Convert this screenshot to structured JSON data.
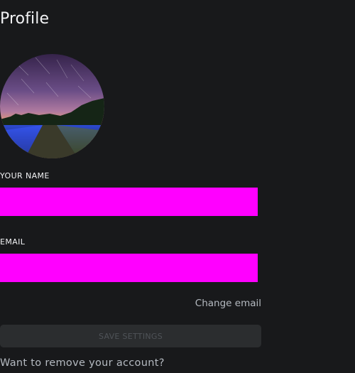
{
  "page": {
    "title": "Profile"
  },
  "avatar": {
    "alt": "Profile picture"
  },
  "form": {
    "name_label": "YOUR NAME",
    "name_value": "",
    "email_label": "EMAIL",
    "email_value": "",
    "change_email_link": "Change email",
    "save_button": "SAVE SETTINGS"
  },
  "footer": {
    "remove_account_link": "Want to remove your account?"
  },
  "colors": {
    "background": "#18191b",
    "field_fill": "#ff00ff",
    "button_disabled_bg": "#2b2d2f",
    "muted_text": "#b5bac1"
  }
}
